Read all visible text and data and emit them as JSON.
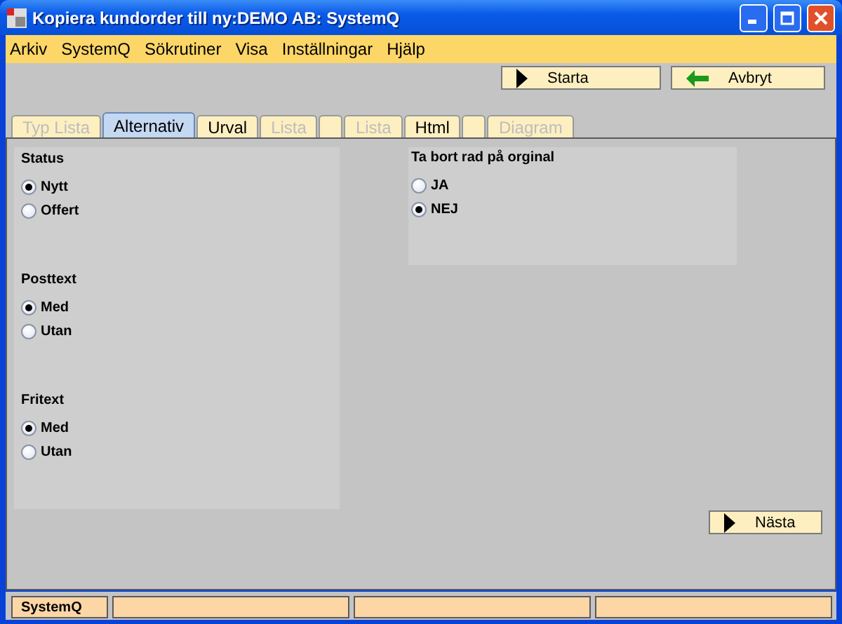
{
  "window": {
    "title": "Kopiera kundorder till ny:DEMO AB: SystemQ"
  },
  "menu": [
    "Arkiv",
    "SystemQ",
    "Sökrutiner",
    "Visa",
    "Inställningar",
    "Hjälp"
  ],
  "toolbar": [
    {
      "label": "Starta",
      "kind": "play"
    },
    {
      "label": "Avbryt",
      "kind": "back"
    }
  ],
  "tabs": [
    {
      "label": "Typ Lista",
      "selected": false,
      "disabled": true
    },
    {
      "label": "Alternativ",
      "selected": true,
      "disabled": false
    },
    {
      "label": "Urval",
      "selected": false,
      "disabled": false
    },
    {
      "label": "Lista",
      "selected": false,
      "disabled": true
    },
    {
      "selected": false
    },
    {
      "label": "Lista",
      "selected": false,
      "disabled": true
    },
    {
      "label": "Html",
      "selected": false,
      "disabled": false
    },
    {
      "selected": false
    },
    {
      "label": "Diagram",
      "selected": false,
      "disabled": true
    }
  ],
  "left_groups": [
    {
      "title": "Status",
      "options": [
        {
          "label": "Nytt",
          "selected": true
        },
        {
          "label": "Offert",
          "selected": false
        }
      ]
    },
    {
      "title": "Posttext",
      "options": [
        {
          "label": "Med",
          "selected": true
        },
        {
          "label": "Utan",
          "selected": false
        }
      ]
    },
    {
      "title": "Fritext",
      "options": [
        {
          "label": "Med",
          "selected": true
        },
        {
          "label": "Utan",
          "selected": false
        }
      ]
    }
  ],
  "right_group": {
    "title": "Ta bort rad på orginal",
    "options": [
      {
        "label": "JA",
        "selected": false
      },
      {
        "label": "NEJ",
        "selected": true
      }
    ]
  },
  "next_button": {
    "label": "Nästa",
    "kind": "play"
  },
  "status_bar": [
    {
      "kind": "text",
      "text": "SystemQ"
    },
    {
      "kind": "empty"
    },
    {
      "kind": "empty"
    },
    {
      "kind": "empty"
    }
  ]
}
